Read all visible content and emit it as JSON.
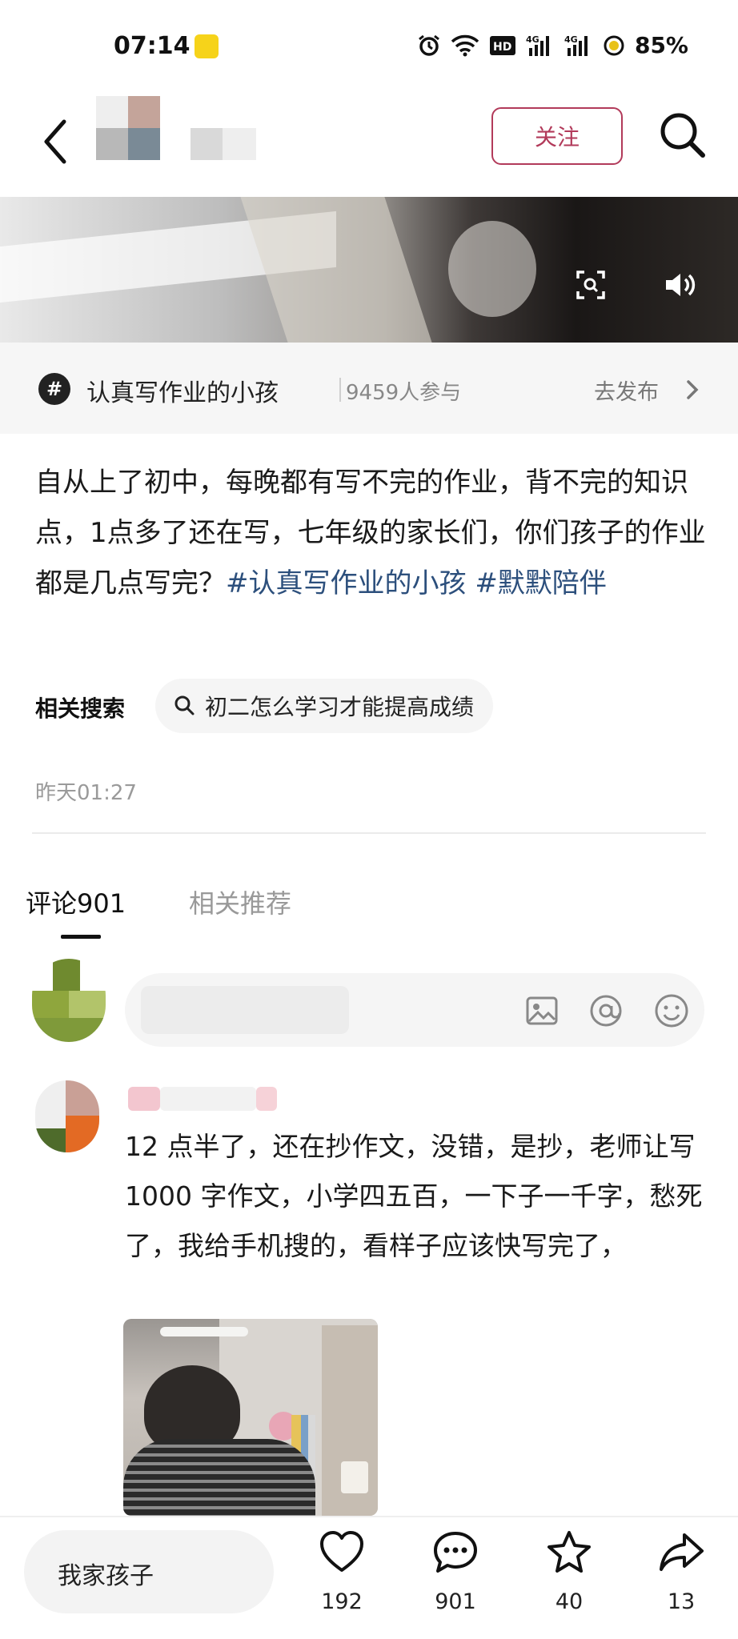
{
  "status_bar": {
    "time": "07:14",
    "battery": "85%"
  },
  "header": {
    "follow_label": "关注"
  },
  "topic": {
    "name": "认真写作业的小孩",
    "participants": "9459人参与",
    "publish_label": "去发布"
  },
  "post": {
    "text": "自从上了初中，每晚都有写不完的作业，背不完的知识点，1点多了还在写，七年级的家长们，你们孩子的作业都是几点写完？",
    "hashtag_1": "#认真写作业的小孩",
    "hashtag_2": "#默默陪伴",
    "related_search_label": "相关搜索",
    "related_search_query": "初二怎么学习才能提高成绩",
    "time": "昨天01:27"
  },
  "tabs": {
    "comments": "评论901",
    "related": "相关推荐"
  },
  "comments": [
    {
      "text": "12 点半了，还在抄作文，没错，是抄，老师让写 1000 字作文，小学四五百，一下子一千字，愁死了，我给手机搜的，看样子应该快写完了，"
    }
  ],
  "bottom_bar": {
    "input_text": "我家孩子",
    "like_count": "192",
    "comment_count": "901",
    "favorite_count": "40",
    "share_count": "13"
  },
  "colors": {
    "accent": "#b23a5a",
    "hashtag": "#2c4f7c"
  }
}
